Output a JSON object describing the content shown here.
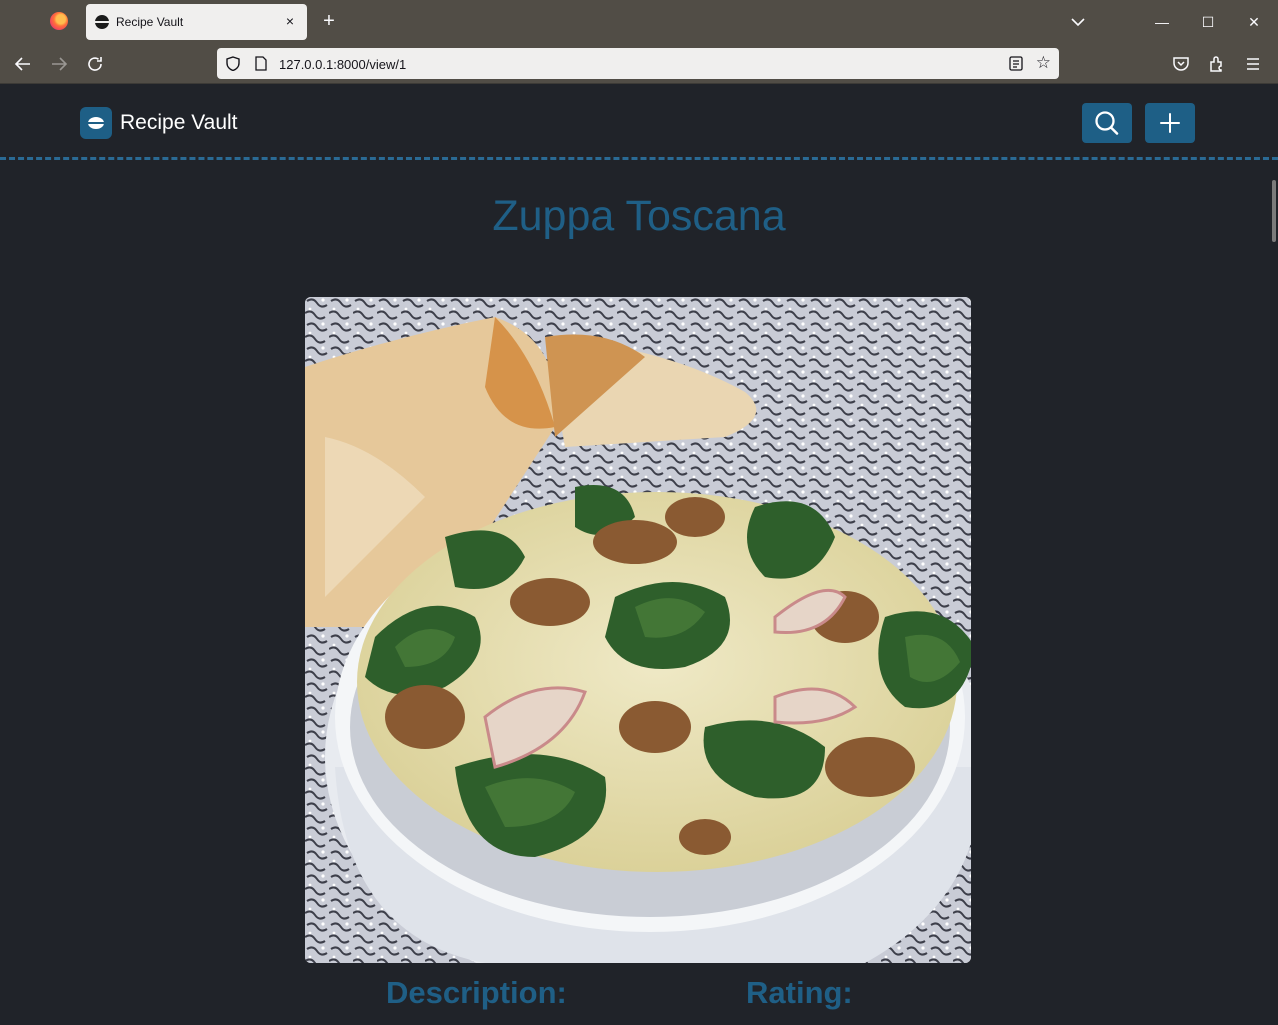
{
  "browser": {
    "tab_title": "Recipe Vault",
    "tab_close": "×",
    "new_tab": "+",
    "url": "127.0.0.1:8000/view/1",
    "minimize": "—",
    "maximize": "☐",
    "close": "✕"
  },
  "app": {
    "brand": "Recipe Vault",
    "search_icon": "search-icon",
    "add_icon": "plus-icon",
    "accent": "#1e5f86"
  },
  "recipe": {
    "title": "Zuppa Toscana",
    "image_alt": "Zuppa Toscana photo",
    "description_label": "Description:",
    "rating_label": "Rating:"
  }
}
